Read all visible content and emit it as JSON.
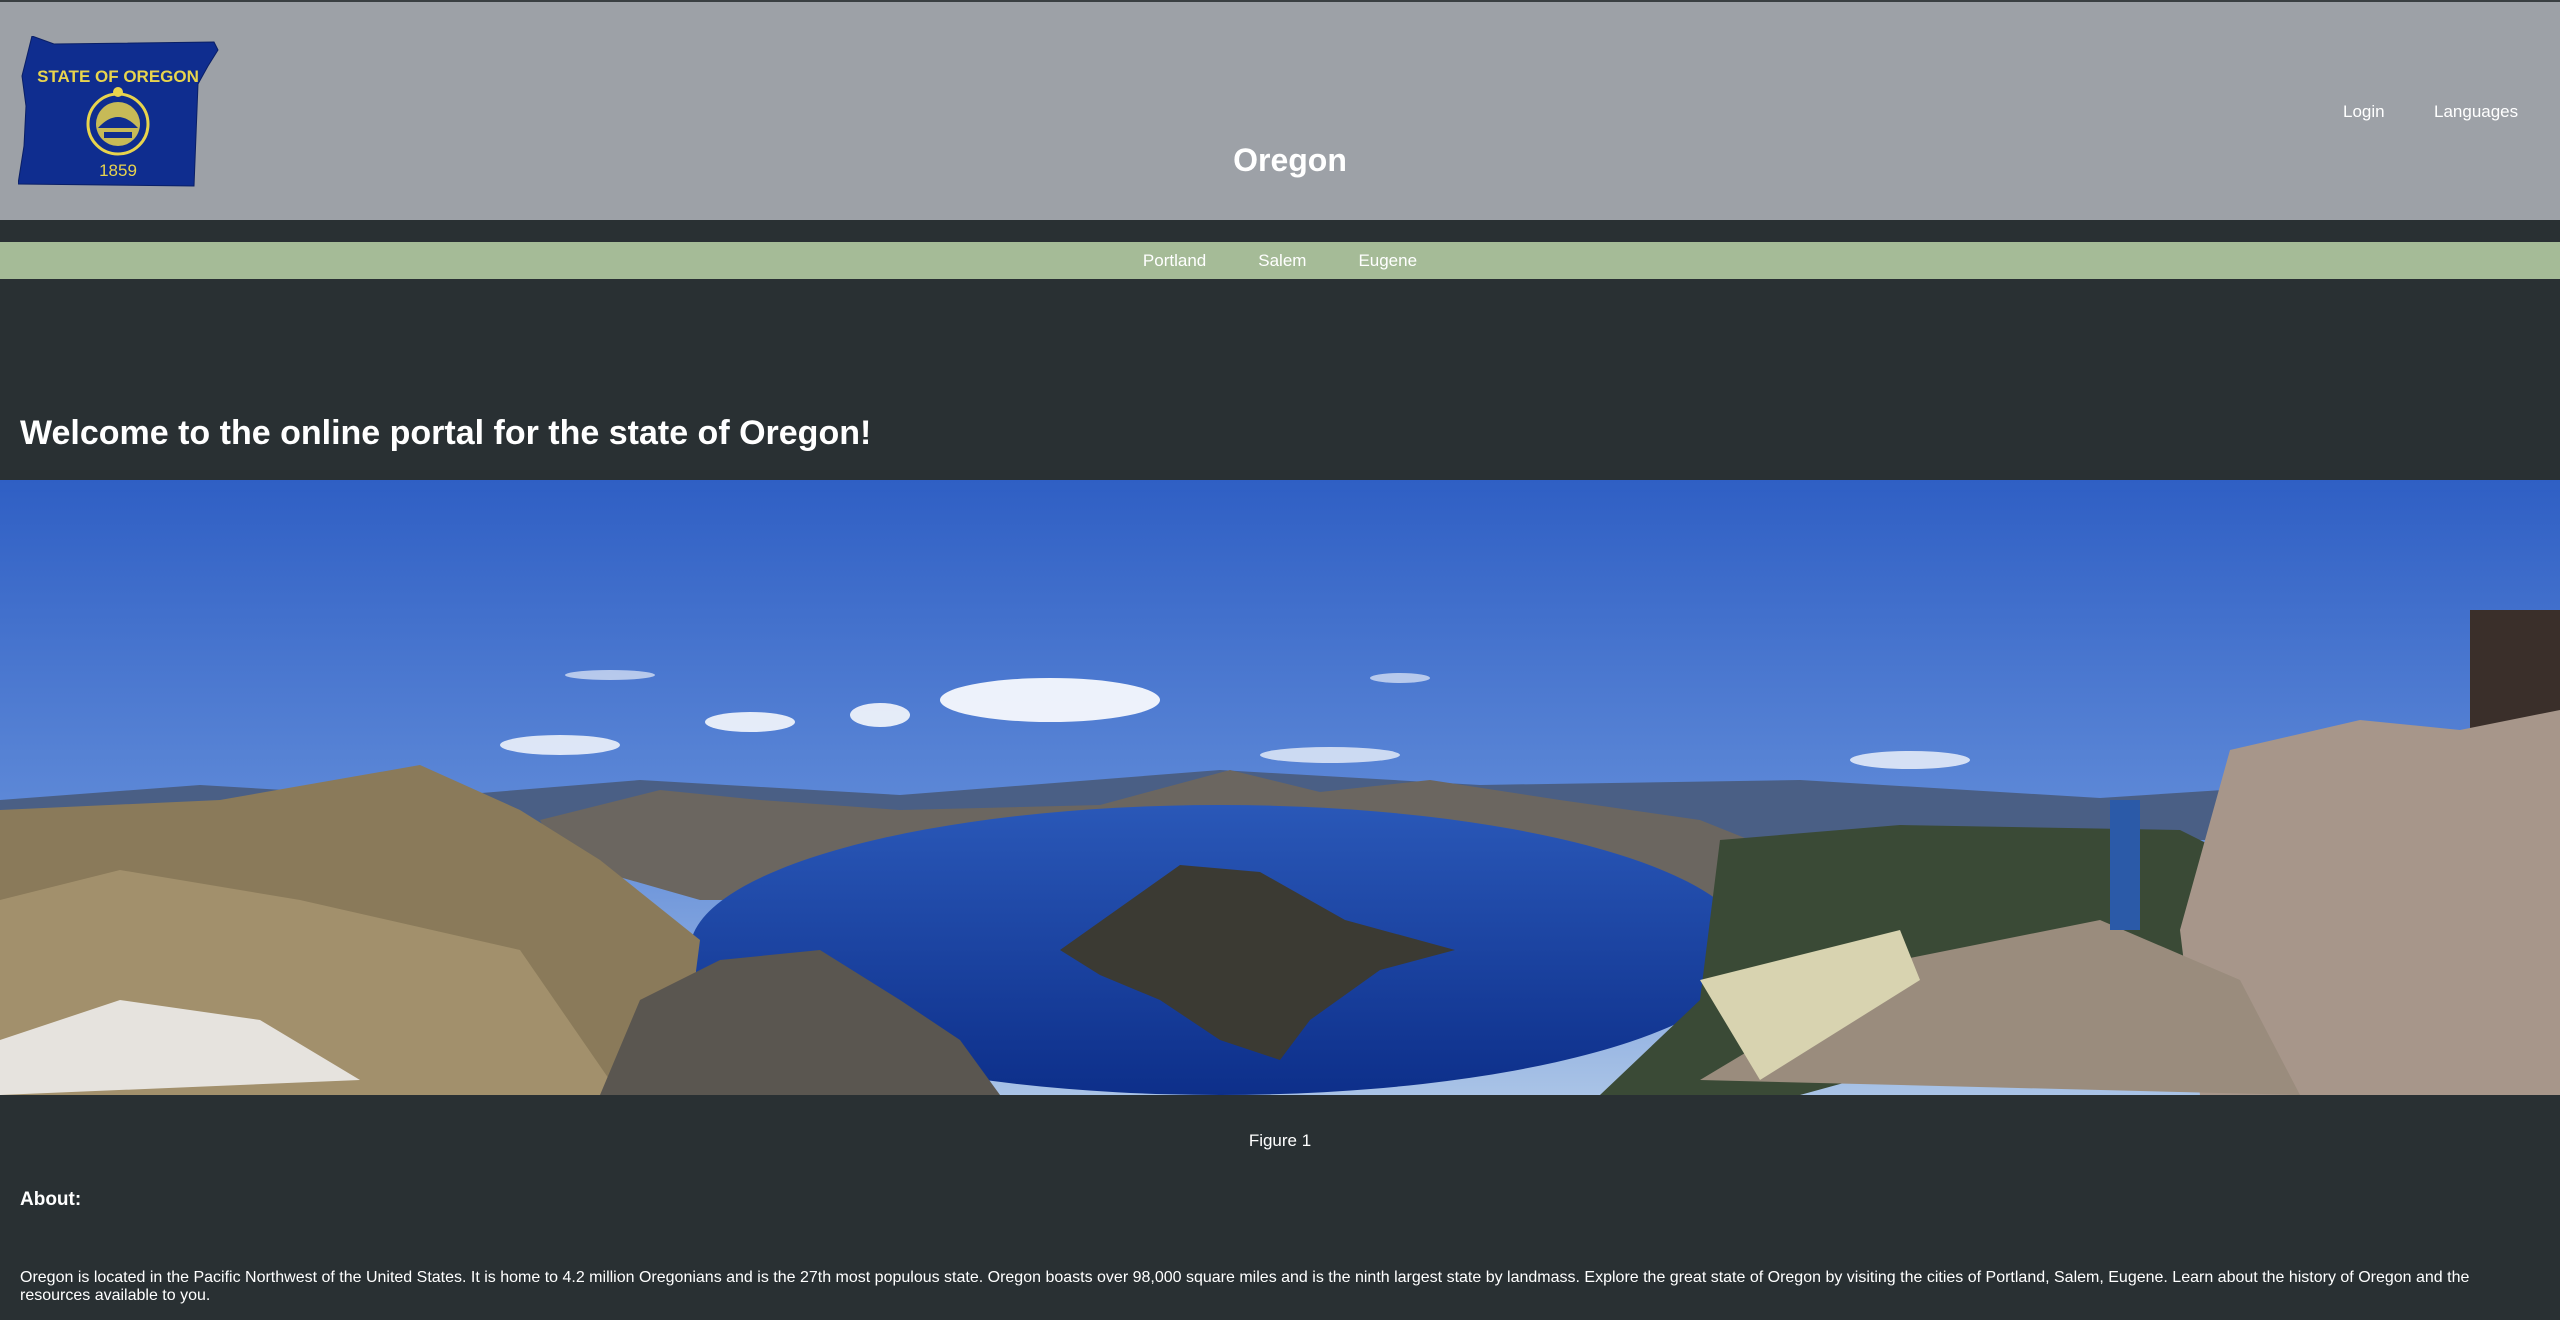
{
  "header": {
    "logo": {
      "caption_top": "STATE OF OREGON",
      "caption_bottom": "1859",
      "colors": {
        "flag_blue": "#0f2d8f",
        "flag_gold": "#e8d44d"
      }
    },
    "title": "Oregon",
    "login_label": "Login",
    "languages_label": "Languages"
  },
  "nav": {
    "items": [
      {
        "label": "Portland"
      },
      {
        "label": "Salem"
      },
      {
        "label": "Eugene"
      }
    ]
  },
  "main": {
    "welcome": "Welcome to the online portal for the state of Oregon!",
    "figure_caption": "Figure 1",
    "about_heading": "About:",
    "about_text": "Oregon is located in the Pacific Northwest of the United States. It is home to 4.2 million Oregonians and is the 27th most populous state. Oregon boasts over 98,000 square miles and is the ninth largest state by landmass. Explore the great state of Oregon by visiting the cities of Portland, Salem, Eugene. Learn about the history of Oregon and the resources available to you."
  },
  "theme": {
    "header_bg": "#9da1a7",
    "nav_bg": "#a5bb97",
    "page_bg": "#293033",
    "text": "#ffffff"
  }
}
